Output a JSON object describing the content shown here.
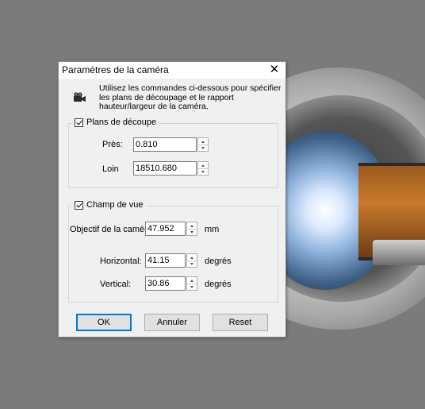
{
  "dialog": {
    "title": "Paramètres de la caméra",
    "close_glyph": "✕",
    "info_text": "Utilisez les commandes ci-dessous pour spécifier les plans de découpage et le rapport hauteur/largeur de la caméra.",
    "info_icon": "camera-icon"
  },
  "clipping": {
    "label": "Plans de découpe",
    "checked": true,
    "near_label": "Près:",
    "near_value": "0.810",
    "far_label": "Loin",
    "far_value": "18510.680"
  },
  "fov": {
    "label": "Champ de vue",
    "checked": true,
    "lens_label": "Objectif de la caméra",
    "lens_value": "47.952",
    "lens_unit": "mm",
    "horizontal_label": "Horizontal:",
    "horizontal_value": "41.15",
    "horizontal_unit": "degrés",
    "vertical_label": "Vertical:",
    "vertical_value": "30.86",
    "vertical_unit": "degrés"
  },
  "buttons": {
    "ok": "OK",
    "cancel": "Annuler",
    "reset": "Reset"
  },
  "colors": {
    "background": "#7b7b7b",
    "dialog": "#f0f0f0",
    "accent": "#0078d7"
  }
}
